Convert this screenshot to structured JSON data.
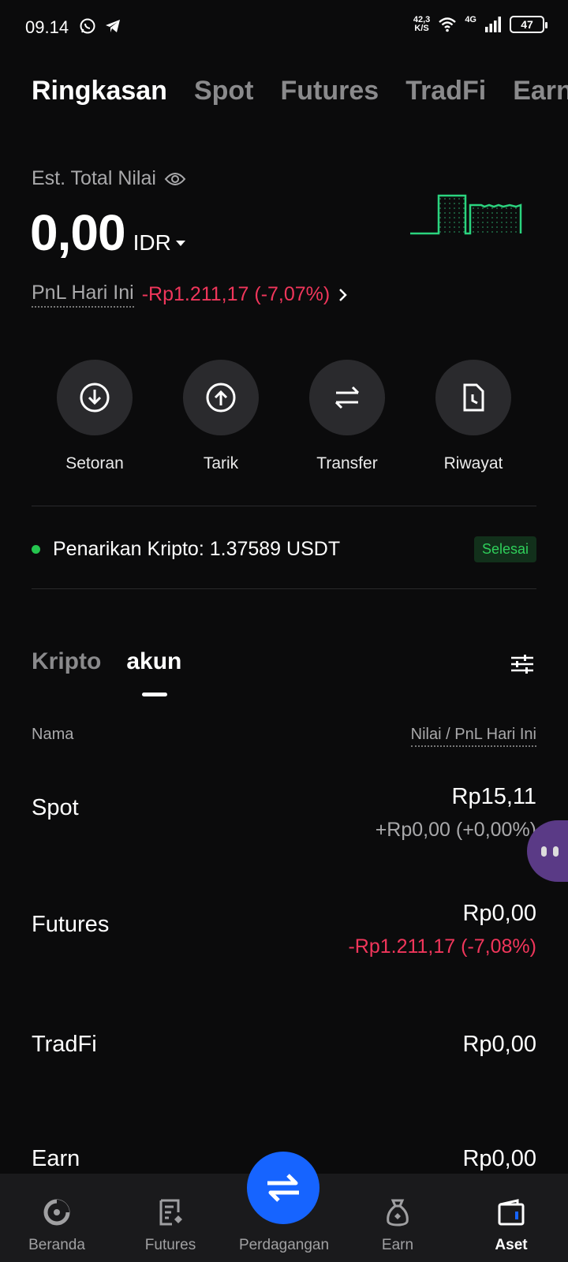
{
  "status_bar": {
    "time": "09.14",
    "speed_value": "42,3",
    "speed_unit": "K/S",
    "network": "4G",
    "battery": "47"
  },
  "top_tabs": [
    "Ringkasan",
    "Spot",
    "Futures",
    "TradFi",
    "Earn"
  ],
  "summary": {
    "est_label": "Est. Total Nilai",
    "balance": "0,00",
    "currency": "IDR",
    "pnl_label": "PnL Hari Ini",
    "pnl_value": "-Rp1.211,17 (-7,07%)"
  },
  "actions": [
    {
      "label": "Setoran",
      "icon": "download-icon"
    },
    {
      "label": "Tarik",
      "icon": "upload-icon"
    },
    {
      "label": "Transfer",
      "icon": "transfer-icon"
    },
    {
      "label": "Riwayat",
      "icon": "history-icon"
    }
  ],
  "notice": {
    "text": "Penarikan Kripto: 1.37589 USDT",
    "status": "Selesai"
  },
  "sub_tabs": [
    "Kripto",
    "akun"
  ],
  "columns": {
    "left": "Nama",
    "right": "Nilai / PnL Hari Ini"
  },
  "accounts": [
    {
      "name": "Spot",
      "value": "Rp15,11",
      "pnl": "+Rp0,00 (+0,00%)"
    },
    {
      "name": "Futures",
      "value": "Rp0,00",
      "pnl": "-Rp1.211,17 (-7,08%)"
    },
    {
      "name": "TradFi",
      "value": "Rp0,00",
      "pnl": ""
    },
    {
      "name": "Earn",
      "value": "Rp0,00",
      "pnl": ""
    }
  ],
  "bottom_nav": [
    {
      "label": "Beranda",
      "icon": "home-icon"
    },
    {
      "label": "Futures",
      "icon": "futures-icon"
    },
    {
      "label": "Perdagangan",
      "icon": "trade-icon"
    },
    {
      "label": "Earn",
      "icon": "earn-icon"
    },
    {
      "label": "Aset",
      "icon": "wallet-icon"
    }
  ],
  "colors": {
    "background": "#0b0b0c",
    "negative": "#f0365b",
    "positive": "#25c54f",
    "accent": "#1664ff"
  }
}
